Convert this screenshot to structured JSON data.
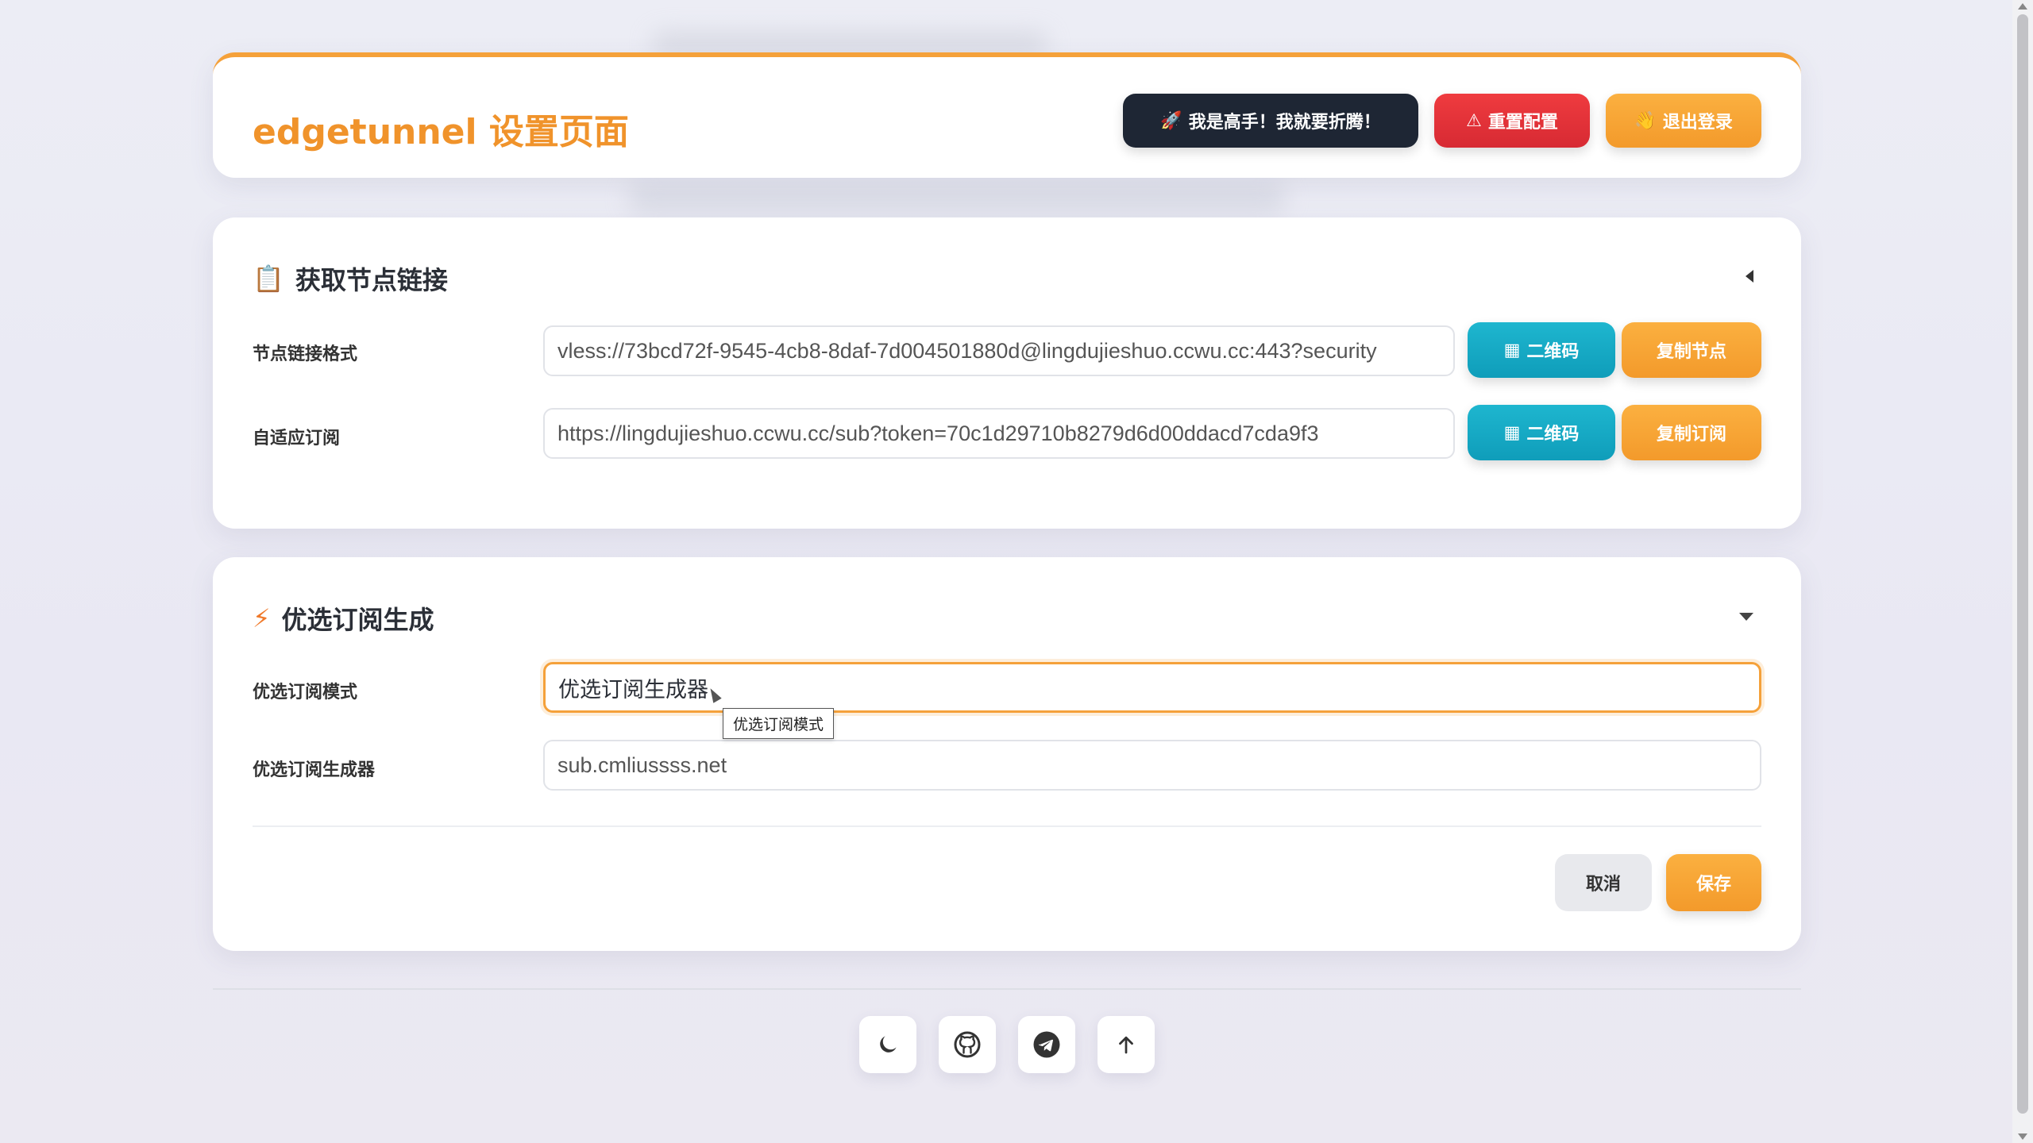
{
  "header": {
    "title": "edgetunnel 设置页面",
    "expert_button": "我是高手！我就要折腾！",
    "reset_button": "重置配置",
    "logout_button": "退出登录"
  },
  "node_section": {
    "title": "获取节点链接",
    "rows": [
      {
        "label": "节点链接格式",
        "value": "vless://73bcd72f-9545-4cb8-8daf-7d004501880d@lingdujieshuo.ccwu.cc:443?security",
        "qr_button": "二维码",
        "copy_button": "复制节点"
      },
      {
        "label": "自适应订阅",
        "value": "https://lingdujieshuo.ccwu.cc/sub?token=70c1d29710b8279d6d00ddacd7cda9f3",
        "qr_button": "二维码",
        "copy_button": "复制订阅"
      }
    ]
  },
  "preferred_section": {
    "title": "优选订阅生成",
    "mode_label": "优选订阅模式",
    "mode_value": "优选订阅生成器",
    "mode_tooltip": "优选订阅模式",
    "generator_label": "优选订阅生成器",
    "generator_value": "sub.cmliussss.net",
    "cancel_button": "取消",
    "save_button": "保存"
  },
  "footer": {
    "icons": [
      "moon-icon",
      "github-icon",
      "telegram-icon",
      "arrow-up-icon"
    ]
  },
  "colors": {
    "accent": "#f0932b",
    "danger": "#d72a33",
    "teal": "#0f9dba",
    "dark": "#1e2634"
  }
}
